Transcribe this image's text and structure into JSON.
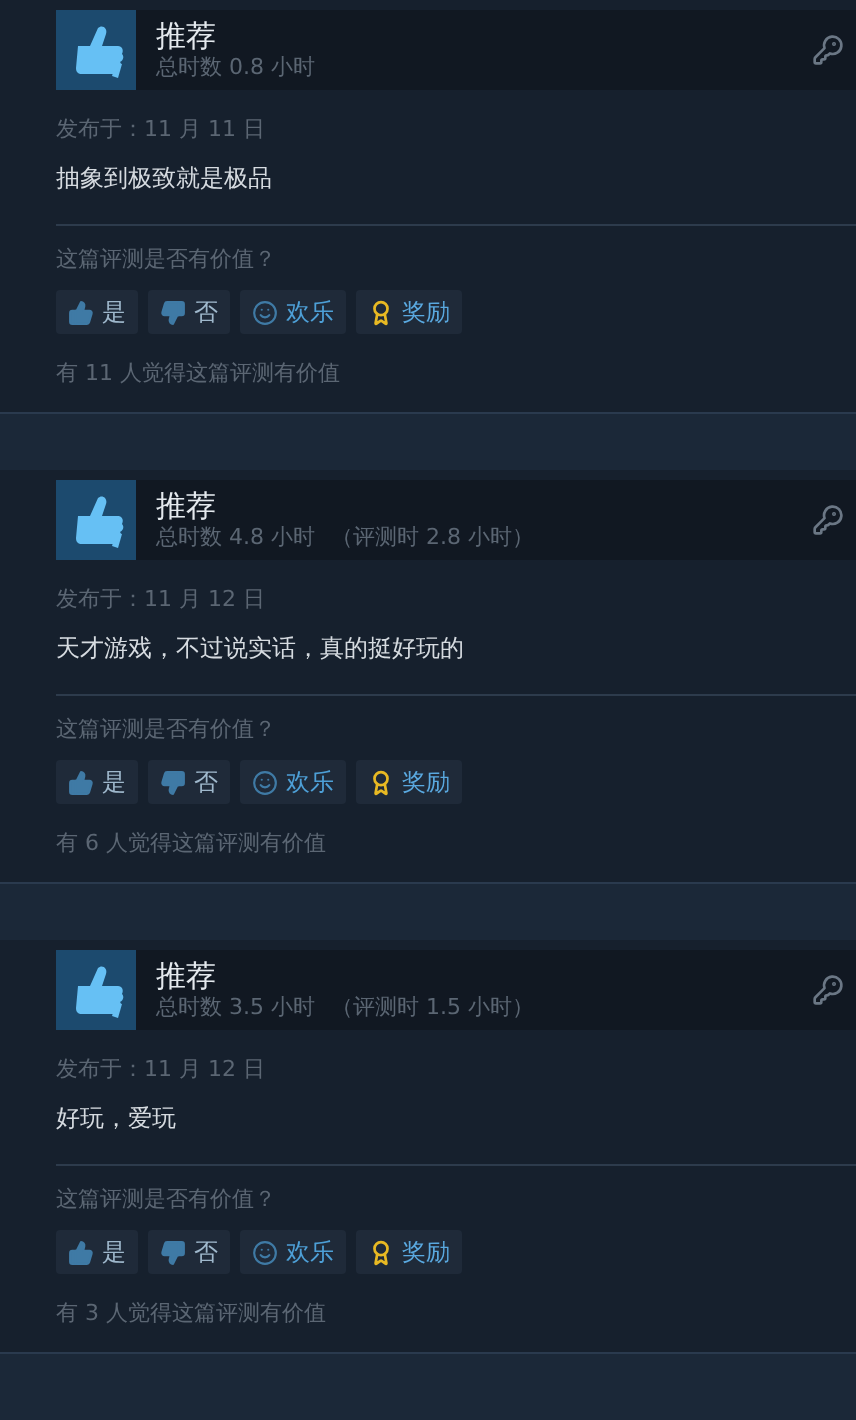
{
  "reviews": [
    {
      "recommendation": "推荐",
      "hours": "总时数 0.8 小时",
      "posted": "发布于：11 月 11 日",
      "text": "抽象到极致就是极品",
      "helpful_prompt": "这篇评测是否有价值？",
      "buttons": [
        {
          "kind": "yes",
          "label": "是"
        },
        {
          "kind": "no",
          "label": "否"
        },
        {
          "kind": "funny",
          "label": "欢乐"
        },
        {
          "kind": "award",
          "label": "奖励"
        }
      ],
      "helpful_count": "有 11 人觉得这篇评测有价值"
    },
    {
      "recommendation": "推荐",
      "hours": "总时数 4.8 小时",
      "review_hours": "（评测时 2.8 小时）",
      "posted": "发布于：11 月 12 日",
      "text": "天才游戏，不过说实话，真的挺好玩的",
      "helpful_prompt": "这篇评测是否有价值？",
      "buttons": [
        {
          "kind": "yes",
          "label": "是"
        },
        {
          "kind": "no",
          "label": "否"
        },
        {
          "kind": "funny",
          "label": "欢乐"
        },
        {
          "kind": "award",
          "label": "奖励"
        }
      ],
      "helpful_count": "有 6 人觉得这篇评测有价值"
    },
    {
      "recommendation": "推荐",
      "hours": "总时数 3.5 小时",
      "review_hours": "（评测时 1.5 小时）",
      "posted": "发布于：11 月 12 日",
      "text": "好玩，爱玩",
      "helpful_prompt": "这篇评测是否有价值？",
      "buttons": [
        {
          "kind": "yes",
          "label": "是"
        },
        {
          "kind": "no",
          "label": "否"
        },
        {
          "kind": "funny",
          "label": "欢乐"
        },
        {
          "kind": "award",
          "label": "奖励"
        }
      ],
      "helpful_count": "有 3 人觉得这篇评测有价值"
    }
  ]
}
